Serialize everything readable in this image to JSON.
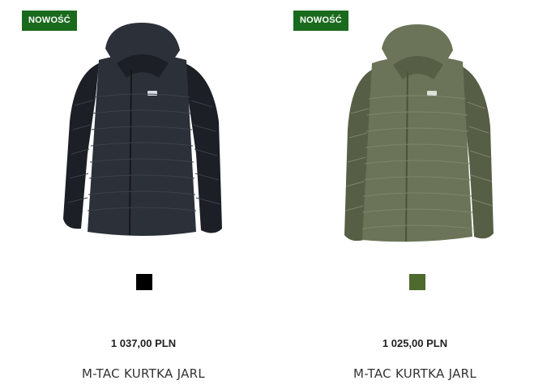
{
  "products": [
    {
      "badge": "NOWOŚĆ",
      "color_hex": "#000000",
      "jacket_color": "#2c3038",
      "jacket_shade": "#1c1f25",
      "jacket_light": "#3b404a",
      "price": "1 037,00 PLN",
      "name": "M-TAC KURTKA JARL"
    },
    {
      "badge": "NOWOŚĆ",
      "color_hex": "#4f6a2e",
      "jacket_color": "#6b7458",
      "jacket_shade": "#565e45",
      "jacket_light": "#7c866a",
      "price": "1 025,00 PLN",
      "name": "M-TAC KURTKA JARL"
    }
  ]
}
